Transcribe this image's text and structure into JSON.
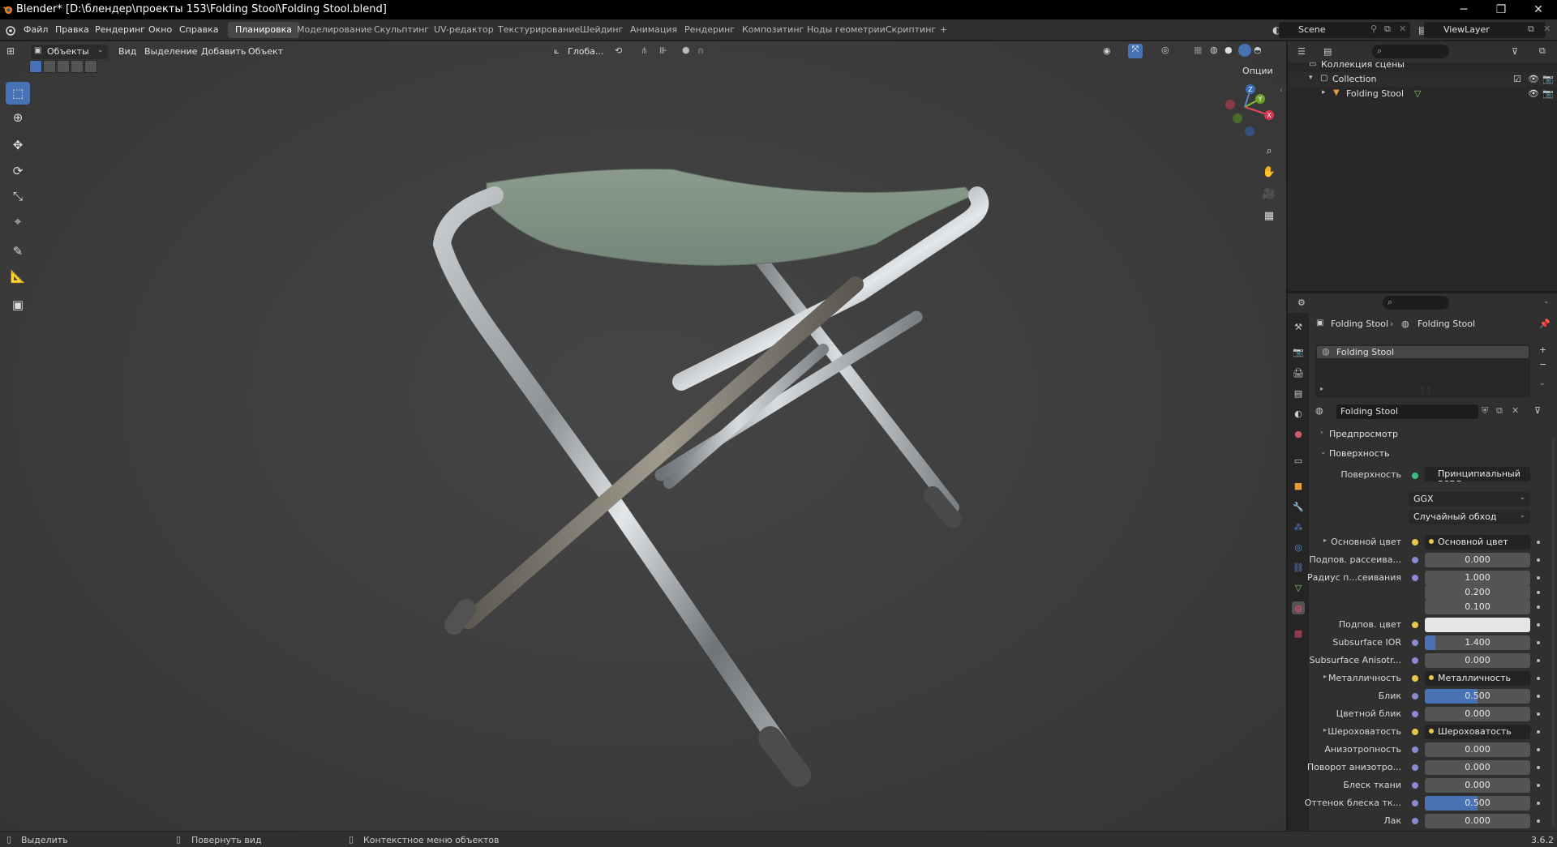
{
  "titlebar": {
    "title": "Blender* [D:\\блендер\\проекты 153\\Folding Stool\\Folding Stool.blend]",
    "minimize": "─",
    "maximize": "❐",
    "close": "✕"
  },
  "menubar": {
    "menus": [
      "Файл",
      "Правка",
      "Рендеринг",
      "Окно",
      "Справка"
    ],
    "workspaces": [
      "Планировка",
      "Моделирование",
      "Скульптинг",
      "UV-редактор",
      "Текстурирование",
      "Шейдинг",
      "Анимация",
      "Рендеринг",
      "Композитинг",
      "Ноды геометрии",
      "Скриптинг"
    ],
    "active_workspace": "Планировка",
    "add_workspace": "+",
    "scene": "Scene",
    "view_layer": "ViewLayer"
  },
  "viewport_header": {
    "mode": "Объекты",
    "menus": [
      "Вид",
      "Выделение",
      "Добавить",
      "Объект"
    ],
    "transform_orientation": "Глоба...",
    "options": "Опции"
  },
  "toolbar": {
    "tools": [
      "select-box",
      "cursor",
      "move",
      "rotate",
      "scale",
      "transform",
      "annotate",
      "measure",
      "add-cube"
    ],
    "active_tool": "select-box"
  },
  "gizmo": {
    "axis_labels": [
      "Z",
      "Y",
      "X"
    ]
  },
  "outliner": {
    "root": "Коллекция сцены",
    "collection": "Collection",
    "object": "Folding Stool"
  },
  "properties": {
    "breadcrumb": [
      "Folding Stool",
      "Folding Stool"
    ],
    "material_slot": "Folding Stool",
    "material_name": "Folding Stool",
    "panels": {
      "preview": "Предпросмотр",
      "surface": "Поверхность"
    },
    "surface_label": "Поверхность",
    "surface_value": "Принципиальный BSDF",
    "distribution": "GGX",
    "subsurface_method": "Случайный обход",
    "rows": [
      {
        "label": "Основной цвет",
        "value": "Основной цвет",
        "kind": "link"
      },
      {
        "label": "Подпов. рассеива...",
        "value": "0.000",
        "kind": "num"
      },
      {
        "label": "Радиус п...сеивания",
        "value": "1.000",
        "kind": "num"
      },
      {
        "label": "",
        "value": "0.200",
        "kind": "num"
      },
      {
        "label": "",
        "value": "0.100",
        "kind": "num"
      },
      {
        "label": "Подпов. цвет",
        "value": "",
        "kind": "color"
      },
      {
        "label": "Subsurface IOR",
        "value": "1.400",
        "kind": "num",
        "fill": 0.1
      },
      {
        "label": "Subsurface Anisotr...",
        "value": "0.000",
        "kind": "num"
      },
      {
        "label": "Металличность",
        "value": "Металличность",
        "kind": "link"
      },
      {
        "label": "Блик",
        "value": "0.500",
        "kind": "num",
        "fill": 0.5
      },
      {
        "label": "Цветной блик",
        "value": "0.000",
        "kind": "num"
      },
      {
        "label": "Шероховатость",
        "value": "Шероховатость",
        "kind": "link"
      },
      {
        "label": "Анизотропность",
        "value": "0.000",
        "kind": "num"
      },
      {
        "label": "Поворот анизотро...",
        "value": "0.000",
        "kind": "num"
      },
      {
        "label": "Блеск ткани",
        "value": "0.000",
        "kind": "num"
      },
      {
        "label": "Оттенок блеска тк...",
        "value": "0.500",
        "kind": "num",
        "fill": 0.5
      },
      {
        "label": "Лак",
        "value": "0.000",
        "kind": "num"
      }
    ]
  },
  "statusbar": {
    "items": [
      "Выделить",
      "Повернуть вид",
      "Контекстное меню объектов"
    ],
    "version": "3.6.2"
  },
  "colors": {
    "accent": "#4772b3",
    "panel": "#303030",
    "viewport": "#3d3d3d"
  }
}
